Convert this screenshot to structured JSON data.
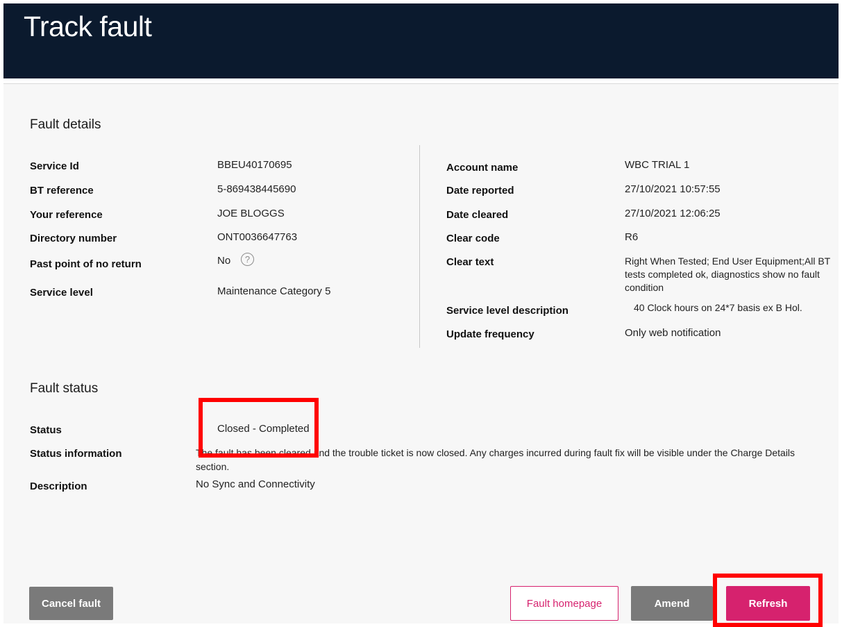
{
  "page": {
    "title": "Track fault"
  },
  "fault_details": {
    "heading": "Fault details",
    "left": [
      {
        "label": "Service Id",
        "value": "BBEU40170695"
      },
      {
        "label": "BT reference",
        "value": "5-869438445690"
      },
      {
        "label": "Your reference",
        "value": "JOE BLOGGS"
      },
      {
        "label": "Directory number",
        "value": "ONT0036647763"
      },
      {
        "label": "Past point of no return",
        "value": "No",
        "icon": "question-circle-icon"
      },
      {
        "label": "Service level",
        "value": "Maintenance Category 5"
      }
    ],
    "right": [
      {
        "label": "Account name",
        "value": "WBC TRIAL 1"
      },
      {
        "label": "Date reported",
        "value": "27/10/2021 10:57:55"
      },
      {
        "label": "Date cleared",
        "value": "27/10/2021 12:06:25"
      },
      {
        "label": "Clear code",
        "value": "R6"
      },
      {
        "label": "Clear text",
        "value": "Right When Tested; End User Equipment;All BT tests completed ok, diagnostics show no fault condition"
      },
      {
        "label": "Service level description",
        "value": "40 Clock hours on 24*7 basis ex B Hol."
      },
      {
        "label": "Update frequency",
        "value": "Only web notification"
      }
    ]
  },
  "fault_status": {
    "heading": "Fault status",
    "rows": [
      {
        "label": "Status",
        "value": "Closed - Completed"
      },
      {
        "label": "Status information",
        "value": "The fault has been cleared and the trouble ticket is now closed. Any charges incurred during fault fix will be visible under the Charge Details section."
      },
      {
        "label": "Description",
        "value": "No Sync and Connectivity"
      }
    ]
  },
  "actions": {
    "cancel": "Cancel fault",
    "homepage": "Fault homepage",
    "amend": "Amend",
    "refresh": "Refresh"
  },
  "colors": {
    "header_bg": "#0b1a2e",
    "accent": "#d6226e",
    "grey_button": "#7a7a7a",
    "highlight": "#ff0000"
  }
}
